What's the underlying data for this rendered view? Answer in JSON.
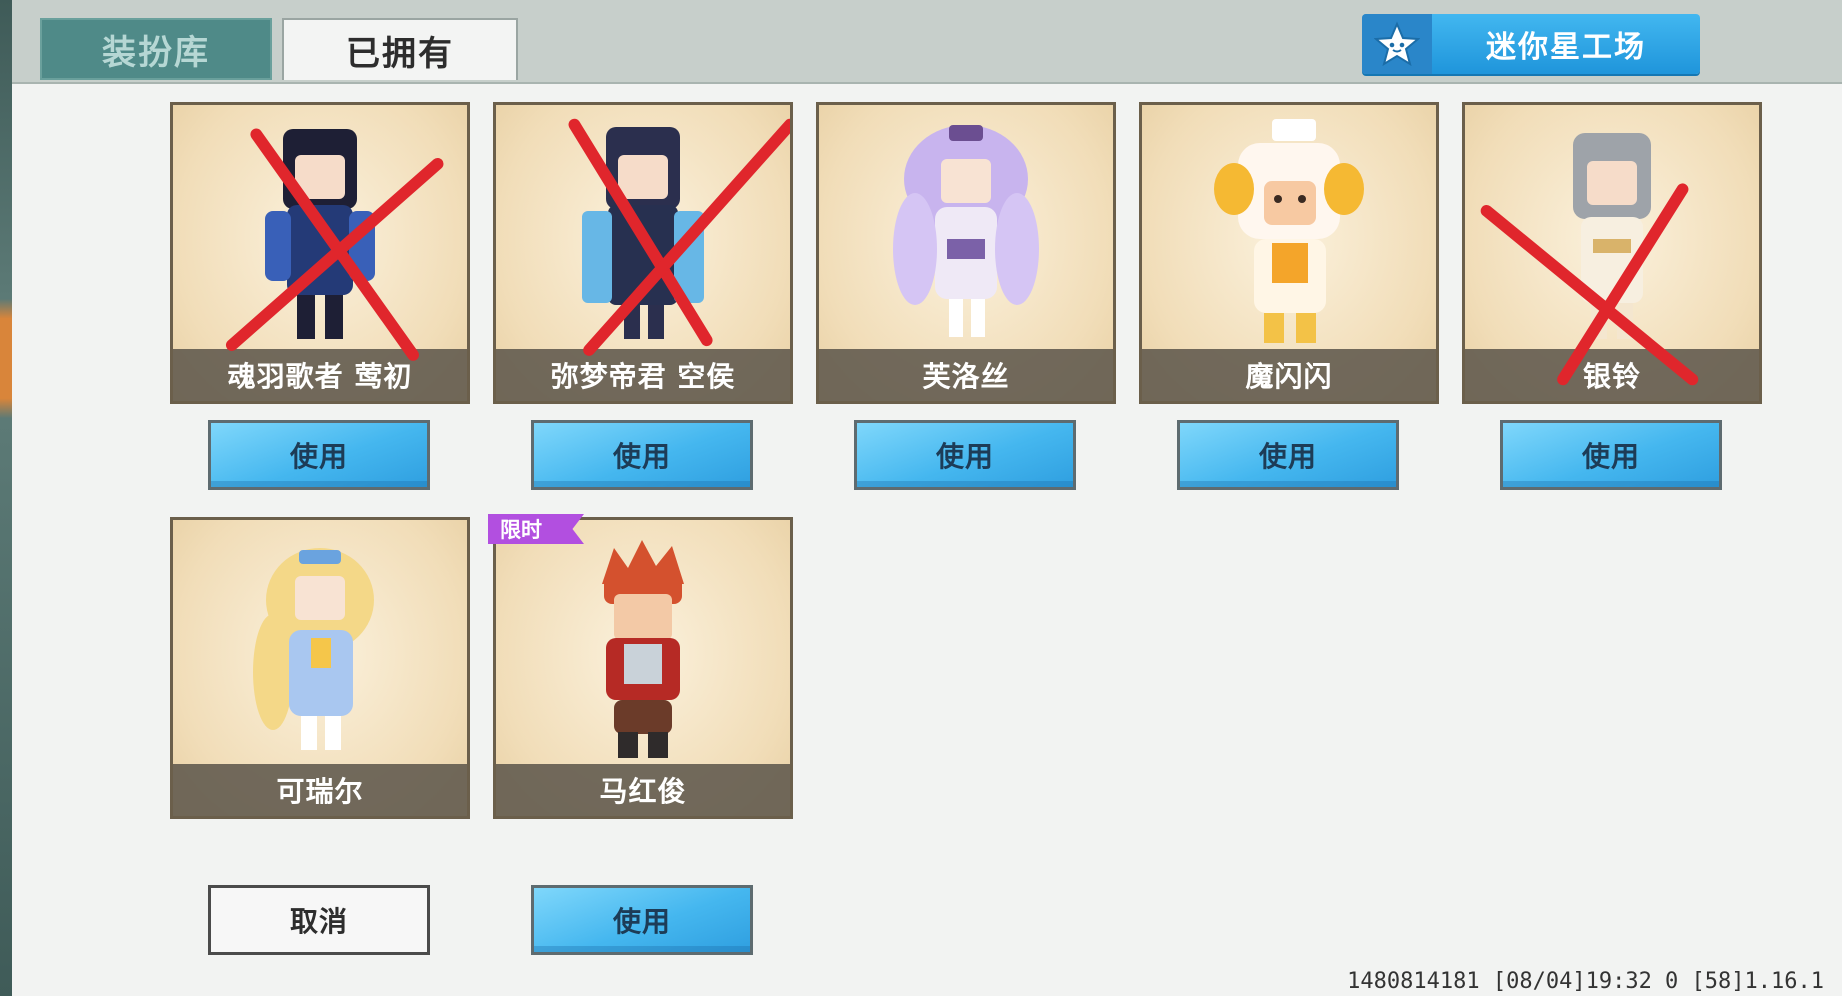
{
  "tabs": {
    "wardrobe": "装扮库",
    "owned": "已拥有"
  },
  "workshop": {
    "label": "迷你星工场",
    "icon": "star-icon"
  },
  "skins": [
    {
      "name": "魂羽歌者 莺初",
      "button": "使用",
      "crossed": true,
      "accent": "#2c2f52"
    },
    {
      "name": "弥梦帝君 空侯",
      "button": "使用",
      "crossed": true,
      "accent": "#2f3c63"
    },
    {
      "name": "芙洛丝",
      "button": "使用",
      "crossed": false,
      "accent": "#b9a4ea"
    },
    {
      "name": "魔闪闪",
      "button": "使用",
      "crossed": false,
      "accent": "#f4b32c"
    },
    {
      "name": "银铃",
      "button": "使用",
      "crossed": true,
      "accent": "#9aa0a5"
    },
    {
      "name": "可瑞尔",
      "button": "取消",
      "crossed": false,
      "accent": "#f3d37a"
    },
    {
      "name": "马红俊",
      "button": "使用",
      "crossed": false,
      "accent": "#c9472a",
      "badge": "限时"
    }
  ],
  "footer": {
    "text": "1480814181   [08/04]19:32 0  [58]1.16.1"
  },
  "colors": {
    "use_button": "#45b7ef",
    "cross": "#e0262c",
    "tab_active": "#4f8a88",
    "badge": "#b24fe0"
  }
}
